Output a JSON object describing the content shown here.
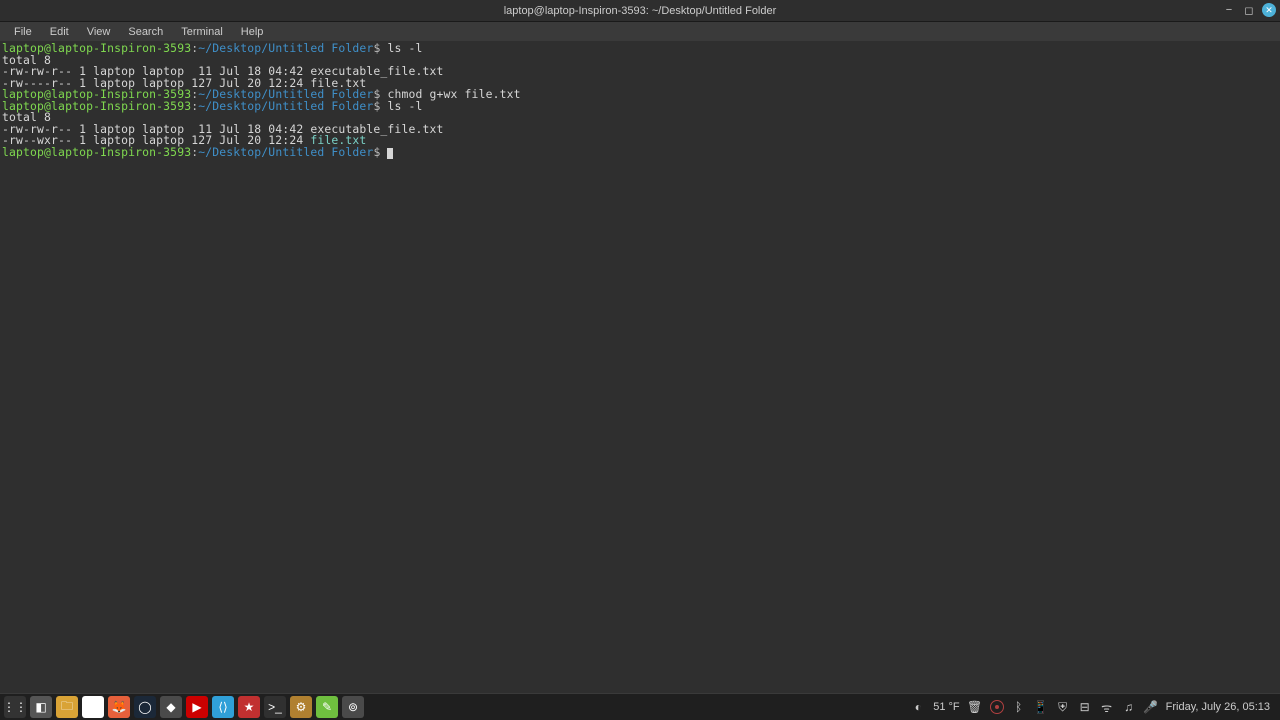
{
  "titlebar": {
    "title": "laptop@laptop-Inspiron-3593: ~/Desktop/Untitled Folder"
  },
  "menubar": {
    "items": [
      "File",
      "Edit",
      "View",
      "Search",
      "Terminal",
      "Help"
    ]
  },
  "terminal": {
    "prompt": {
      "user": "laptop@laptop-Inspiron-3593",
      "sep": ":",
      "path": "~/Desktop/Untitled Folder",
      "dollar": "$"
    },
    "lines": [
      {
        "type": "prompt",
        "cmd": "ls -l"
      },
      {
        "type": "out",
        "text": "total 8"
      },
      {
        "type": "out",
        "text": "-rw-rw-r-- 1 laptop laptop  11 Jul 18 04:42 executable_file.txt"
      },
      {
        "type": "out",
        "text": "-rw----r-- 1 laptop laptop 127 Jul 20 12:24 file.txt"
      },
      {
        "type": "prompt",
        "cmd": "chmod g+wx file.txt"
      },
      {
        "type": "prompt",
        "cmd": "ls -l"
      },
      {
        "type": "out",
        "text": "total 8"
      },
      {
        "type": "out",
        "text": "-rw-rw-r-- 1 laptop laptop  11 Jul 18 04:42 executable_file.txt"
      },
      {
        "type": "out-hl",
        "pre": "-rw--wxr-- 1 laptop laptop 127 Jul 20 12:24 ",
        "hl": "file.txt"
      },
      {
        "type": "prompt-cursor"
      }
    ]
  },
  "taskbar": {
    "apps": [
      {
        "name": "menu-icon",
        "bg": "#333",
        "glyph": "⋮⋮"
      },
      {
        "name": "show-desktop-icon",
        "bg": "#555",
        "glyph": "◧"
      },
      {
        "name": "files-icon",
        "bg": "#d9a336",
        "glyph": "🗀"
      },
      {
        "name": "chrome-icon",
        "bg": "#fff",
        "glyph": "◉"
      },
      {
        "name": "firefox-icon",
        "bg": "#e6603b",
        "glyph": "🦊"
      },
      {
        "name": "steam-icon",
        "bg": "#1b2838",
        "glyph": "◯"
      },
      {
        "name": "app-icon",
        "bg": "#4a4a4a",
        "glyph": "◆"
      },
      {
        "name": "youtube-icon",
        "bg": "#cc0000",
        "glyph": "▶"
      },
      {
        "name": "vscode-icon",
        "bg": "#30a0d8",
        "glyph": "⟨⟩"
      },
      {
        "name": "app2-icon",
        "bg": "#c13030",
        "glyph": "★"
      },
      {
        "name": "terminal-icon",
        "bg": "#303030",
        "glyph": ">_"
      },
      {
        "name": "settings-icon",
        "bg": "#b08030",
        "glyph": "⚙"
      },
      {
        "name": "editor-icon",
        "bg": "#6fbf3f",
        "glyph": "✎"
      },
      {
        "name": "mint-icon",
        "bg": "#4a4a4a",
        "glyph": "⊚"
      }
    ],
    "tray": {
      "weather": "51 °F",
      "datetime": "Friday, July 26, 05:13"
    }
  }
}
